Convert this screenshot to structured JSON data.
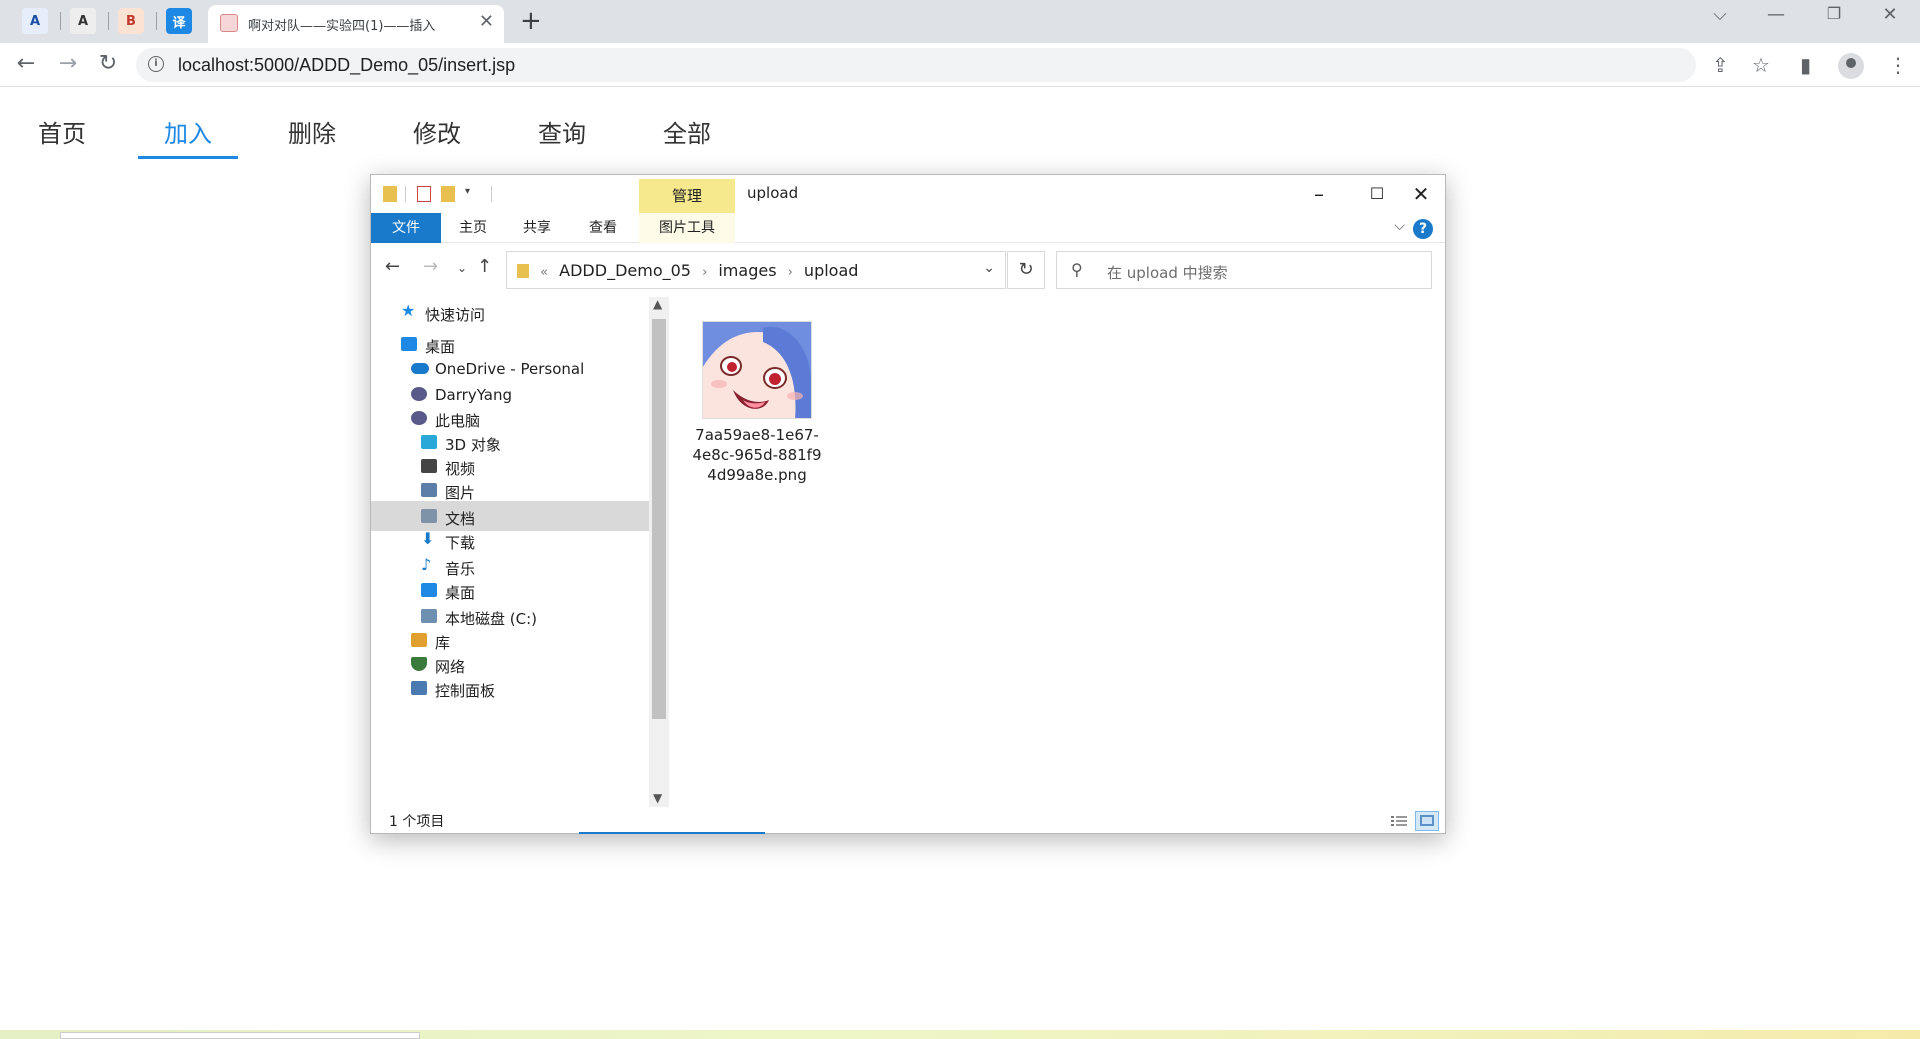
{
  "browser": {
    "pinned_tabs": [
      {
        "icon": "A",
        "color": "#1a4fa3",
        "bg": "#e6eefc"
      },
      {
        "icon": "A",
        "color": "#333333",
        "bg": "#eeeeee"
      },
      {
        "icon": "B",
        "color": "#c0392b",
        "bg": "#fbe3d4"
      },
      {
        "icon": "译",
        "color": "#ffffff",
        "bg": "#1e88e5"
      }
    ],
    "active_tab_title": "啊对对队——实验四(1)——插入",
    "url": "localhost:5000/ADDD_Demo_05/insert.jsp"
  },
  "page_nav": {
    "items": [
      "首页",
      "加入",
      "删除",
      "修改",
      "查询",
      "全部"
    ],
    "active_index": 1
  },
  "explorer": {
    "manage_tab": "管理",
    "title": "upload",
    "ribbon_tabs": [
      "文件",
      "主页",
      "共享",
      "查看",
      "图片工具"
    ],
    "breadcrumb": [
      "ADDD_Demo_05",
      "images",
      "upload"
    ],
    "search_placeholder": "在 upload 中搜索",
    "tree": [
      {
        "label": "快速访问",
        "icon": "star-icon",
        "indent": 0,
        "color": "#1e88e5"
      },
      {
        "label": "桌面",
        "icon": "desktop-icon",
        "indent": 0,
        "color": "#1e88e5"
      },
      {
        "label": "OneDrive - Personal",
        "icon": "cloud-icon",
        "indent": 1,
        "color": "#1979ca"
      },
      {
        "label": "DarryYang",
        "icon": "user-icon",
        "indent": 1,
        "color": "#5a5a8a"
      },
      {
        "label": "此电脑",
        "icon": "computer-icon",
        "indent": 1,
        "color": "#5a5a8a"
      },
      {
        "label": "3D 对象",
        "icon": "cube-icon",
        "indent": 2,
        "color": "#2aa8d8"
      },
      {
        "label": "视频",
        "icon": "video-icon",
        "indent": 2,
        "color": "#444444"
      },
      {
        "label": "图片",
        "icon": "picture-icon",
        "indent": 2,
        "color": "#5b7fa8"
      },
      {
        "label": "文档",
        "icon": "document-icon",
        "indent": 2,
        "color": "#7f93a8"
      },
      {
        "label": "下载",
        "icon": "download-icon",
        "indent": 2,
        "color": "#1979ca"
      },
      {
        "label": "音乐",
        "icon": "music-icon",
        "indent": 2,
        "color": "#1979ca"
      },
      {
        "label": "桌面",
        "icon": "desktop-icon",
        "indent": 2,
        "color": "#1e88e5"
      },
      {
        "label": "本地磁盘 (C:)",
        "icon": "drive-icon",
        "indent": 2,
        "color": "#6d8fb0"
      },
      {
        "label": "库",
        "icon": "library-icon",
        "indent": 1,
        "color": "#e0a030"
      },
      {
        "label": "网络",
        "icon": "network-icon",
        "indent": 1,
        "color": "#3a7a3a"
      },
      {
        "label": "控制面板",
        "icon": "control-panel-icon",
        "indent": 1,
        "color": "#4a7ab0"
      }
    ],
    "selected_tree_index": 8,
    "file": {
      "name": "7aa59ae8-1e67-4e8c-965d-881f94d99a8e.png"
    },
    "status": "1 个项目"
  }
}
